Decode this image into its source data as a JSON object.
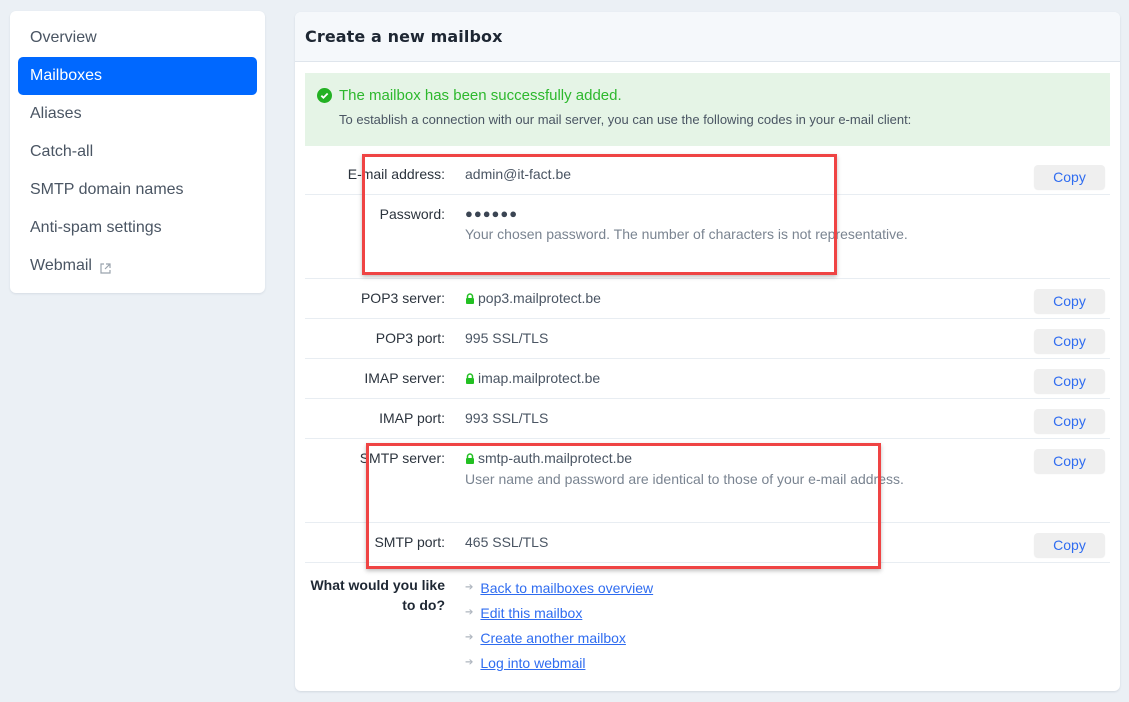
{
  "sidebar": {
    "items": [
      {
        "label": "Overview",
        "active": false
      },
      {
        "label": "Mailboxes",
        "active": true
      },
      {
        "label": "Aliases",
        "active": false
      },
      {
        "label": "Catch-all",
        "active": false
      },
      {
        "label": "SMTP domain names",
        "active": false
      },
      {
        "label": "Anti-spam settings",
        "active": false
      },
      {
        "label": "Webmail",
        "active": false,
        "icon": "external-link-icon"
      }
    ]
  },
  "card": {
    "title": "Create a new mailbox",
    "alert": {
      "icon": "check-circle-icon",
      "title": "The mailbox has been successfully added.",
      "text": "To establish a connection with our mail server, you can use the following codes in your e-mail client:"
    },
    "rows": [
      {
        "label": "E-mail address:",
        "value": "admin@it-fact.be",
        "copy": "Copy"
      },
      {
        "label": "Password:",
        "value": "●●●●●●",
        "hint": "Your chosen password. The number of characters is not representative."
      },
      {
        "label": "POP3 server:",
        "value": "pop3.mailprotect.be",
        "lock": true,
        "copy": "Copy"
      },
      {
        "label": "POP3 port:",
        "value": "995 SSL/TLS",
        "copy": "Copy"
      },
      {
        "label": "IMAP server:",
        "value": "imap.mailprotect.be",
        "lock": true,
        "copy": "Copy"
      },
      {
        "label": "IMAP port:",
        "value": "993 SSL/TLS",
        "copy": "Copy"
      },
      {
        "label": "SMTP server:",
        "value": "smtp-auth.mailprotect.be",
        "lock": true,
        "hint": "User name and password are identical to those of your e-mail address.",
        "copy": "Copy"
      },
      {
        "label": "SMTP port:",
        "value": "465 SSL/TLS",
        "copy": "Copy"
      }
    ],
    "actions": {
      "label": "What would you like to do?",
      "links": [
        "Back to mailboxes overview",
        "Edit this mailbox",
        "Create another mailbox",
        "Log into webmail"
      ]
    }
  },
  "colors": {
    "accent": "#0068ff",
    "success": "#2db82d",
    "link": "#2f6cf0",
    "highlight": "#ef4444"
  }
}
